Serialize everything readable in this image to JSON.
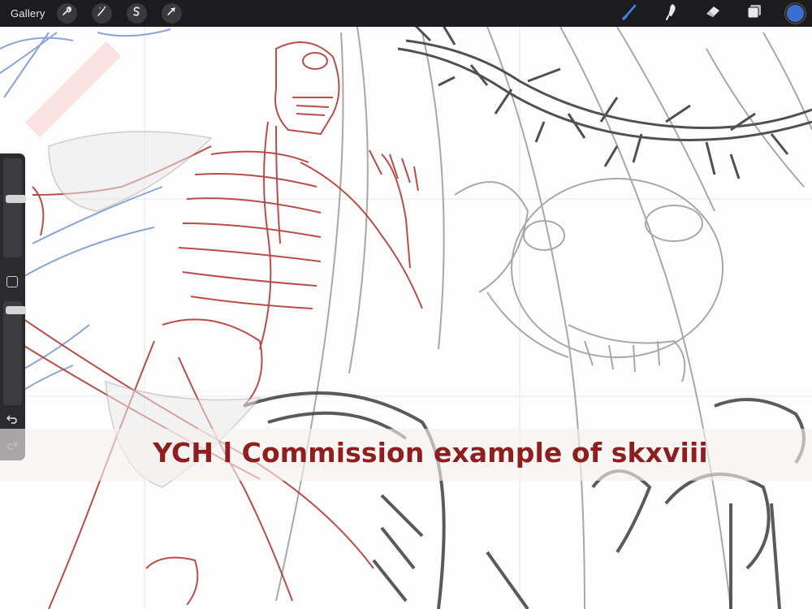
{
  "topbar": {
    "gallery_label": "Gallery",
    "left_tools": [
      {
        "name": "actions",
        "icon": "wrench-icon"
      },
      {
        "name": "adjustments",
        "icon": "magic-wand-icon"
      },
      {
        "name": "selection",
        "icon": "selection-s-icon"
      },
      {
        "name": "transform",
        "icon": "arrow-cursor-icon"
      }
    ],
    "right_tools": [
      {
        "name": "brush",
        "icon": "brush-icon",
        "active": true
      },
      {
        "name": "smudge",
        "icon": "smudge-icon",
        "active": false
      },
      {
        "name": "eraser",
        "icon": "eraser-icon",
        "active": false
      },
      {
        "name": "layers",
        "icon": "layers-icon",
        "active": false
      }
    ],
    "current_color": "#3a6fd0",
    "active_tool_color": "#3d84f0"
  },
  "sidebar": {
    "brush_size_level": 0.6,
    "opacity_level": 0.95,
    "modify_icon": "square-icon",
    "undo_icon": "undo-icon",
    "redo_icon": "redo-icon"
  },
  "caption": {
    "text": "YCH l Commission example of skxviii",
    "color": "#8f1f1f"
  },
  "canvas": {
    "sketch_colors": {
      "red": "#b33a36",
      "gray": "#8a8a8a",
      "dark": "#4a4a4a",
      "blue": "#5a7fc2"
    }
  }
}
